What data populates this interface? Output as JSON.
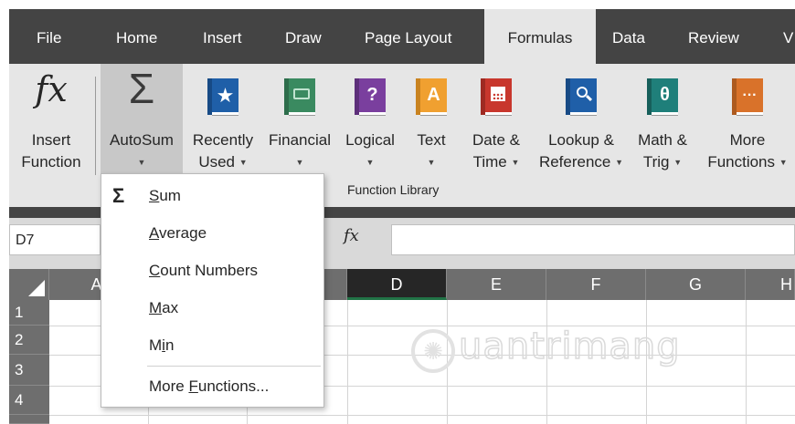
{
  "ribbon_tabs": [
    {
      "label": "File"
    },
    {
      "label": "Home"
    },
    {
      "label": "Insert"
    },
    {
      "label": "Draw"
    },
    {
      "label": "Page Layout"
    },
    {
      "label": "Formulas"
    },
    {
      "label": "Data"
    },
    {
      "label": "Review"
    },
    {
      "label": "V"
    }
  ],
  "active_tab": "Formulas",
  "commands": {
    "insert_function": {
      "icon_text": "fx",
      "line1": "Insert",
      "line2": "Function"
    },
    "autosum": {
      "icon_text": "Σ",
      "line1": "AutoSum"
    },
    "recently_used": {
      "icon": "star-book-icon",
      "line1": "Recently",
      "line2": "Used"
    },
    "financial": {
      "icon": "money-book-icon",
      "line1": "Financial"
    },
    "logical": {
      "icon_text": "?",
      "line1": "Logical"
    },
    "text": {
      "icon_text": "A",
      "line1": "Text"
    },
    "date_time": {
      "icon": "calendar-book-icon",
      "line1": "Date &",
      "line2": "Time"
    },
    "lookup_reference": {
      "icon": "magnifier-book-icon",
      "line1": "Lookup &",
      "line2": "Reference"
    },
    "math_trig": {
      "icon_text": "θ",
      "line1": "Math &",
      "line2": "Trig"
    },
    "more_functions": {
      "icon_text": "···",
      "line1": "More",
      "line2": "Functions"
    }
  },
  "group_label": "Function Library",
  "name_box": "D7",
  "formula_fx": "fx",
  "columns": [
    "A",
    "D",
    "E",
    "F",
    "G",
    "H"
  ],
  "selected_column": "D",
  "rows": [
    "1",
    "2",
    "3",
    "4"
  ],
  "autosum_menu": {
    "sum_icon": "Σ",
    "items": [
      {
        "pre": "",
        "key": "S",
        "post": "um"
      },
      {
        "pre": "",
        "key": "A",
        "post": "verage"
      },
      {
        "pre": "",
        "key": "C",
        "post": "ount Numbers"
      },
      {
        "pre": "",
        "key": "M",
        "post": "ax"
      },
      {
        "pre": "M",
        "key": "i",
        "post": "n"
      },
      {
        "pre": "More ",
        "key": "F",
        "post": "unctions..."
      }
    ]
  },
  "watermark_text": "uantrimang",
  "colors": {
    "tab_bar": "#444444",
    "ribbon": "#e6e6e6",
    "selected_column_underline": "#217346",
    "book_blue": "#1f5fa8",
    "book_green": "#3a8a60",
    "book_purple": "#7a3f9e",
    "book_orange": "#f0a030",
    "book_red": "#c8372d",
    "book_teal": "#1f7f7a",
    "book_darkorange": "#d9722a"
  }
}
